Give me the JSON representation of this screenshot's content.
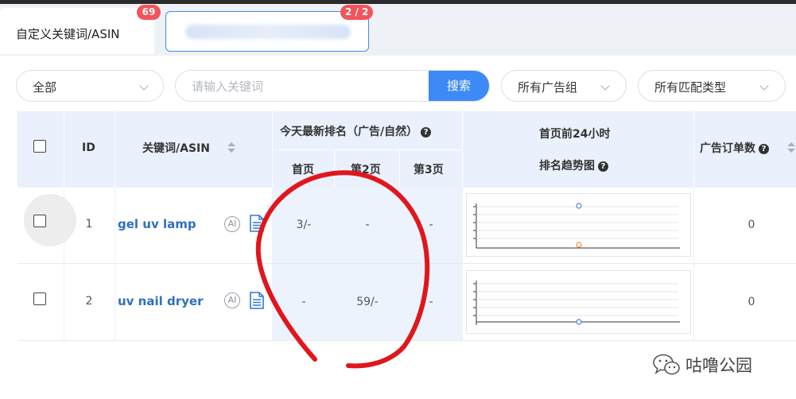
{
  "tabs": [
    {
      "label": "自定义关键词/ASIN",
      "badge": "69"
    },
    {
      "label": "",
      "badge": "2 / 2"
    }
  ],
  "filters": {
    "scope_value": "全部",
    "search_placeholder": "请输入关键词",
    "search_button": "搜索",
    "ad_group_value": "所有广告组",
    "match_type_value": "所有匹配类型"
  },
  "table": {
    "headers": {
      "id": "ID",
      "keyword": "关键词/ASIN",
      "rank_group": "今天最新排名（广告/自然）",
      "page1": "首页",
      "page2": "第2页",
      "page3": "第3页",
      "trend_line1": "首页前24小时",
      "trend_line2": "排名趋势图",
      "ad_orders": "广告订单数"
    },
    "rows": [
      {
        "id": "1",
        "keyword": "gel uv lamp",
        "page1": "3/-",
        "page2": "-",
        "page3": "-",
        "ad_orders": "0"
      },
      {
        "id": "2",
        "keyword": "uv nail dryer",
        "page1": "-",
        "page2": "59/-",
        "page3": "-",
        "ad_orders": "0"
      }
    ]
  },
  "icons": {
    "ai": "AI",
    "doc": "document-icon",
    "help": "?"
  },
  "watermark": {
    "text": "咕噜公园"
  },
  "colors": {
    "accent": "#3d8af7",
    "badge": "#f2545b",
    "link": "#2f6fc2",
    "annotation": "#e0161c"
  }
}
